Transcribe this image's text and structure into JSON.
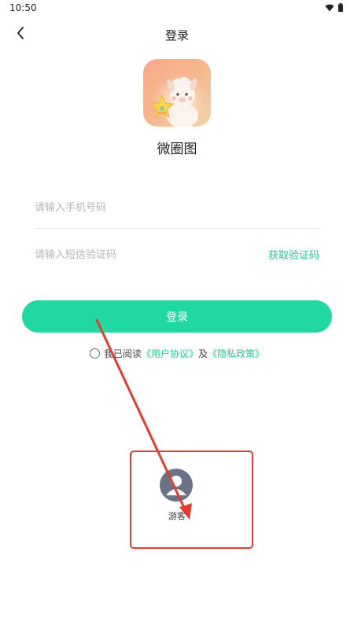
{
  "status_bar": {
    "time": "10:50",
    "icons": [
      "wifi-icon",
      "battery-icon"
    ]
  },
  "header": {
    "back_icon": "chevron-left-icon",
    "title": "登录"
  },
  "app": {
    "logo_icon": "app-logo-alpaca-icon",
    "name": "微圈图"
  },
  "form": {
    "phone_placeholder": "请输入手机号码",
    "phone_value": "",
    "code_placeholder": "请输入短信验证码",
    "code_value": "",
    "get_code_label": "获取验证码",
    "login_label": "登录"
  },
  "agreement": {
    "checked": false,
    "prefix": "我已阅读",
    "user_agreement": "《用户协议》",
    "conjunction": "及",
    "privacy_policy": "《隐私政策》"
  },
  "guest": {
    "icon": "user-avatar-icon",
    "label": "游客"
  },
  "colors": {
    "accent": "#1fd8a2",
    "link": "#22c98f",
    "annotation_red": "#e53b2f",
    "avatar_gray": "#6b7287"
  }
}
